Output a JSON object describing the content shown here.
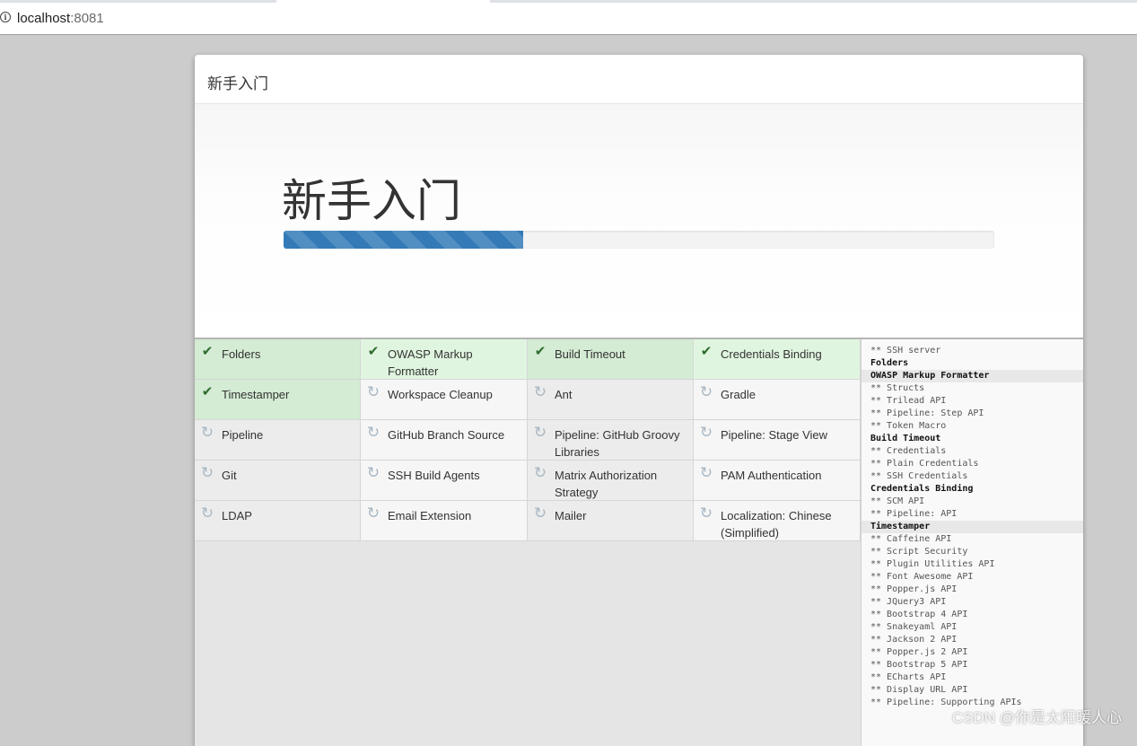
{
  "browser": {
    "host": "localhost",
    "port": ":8081"
  },
  "dialog": {
    "title": "新手入门",
    "hero_title": "新手入门",
    "progress": 0.337
  },
  "plugins": [
    {
      "name": "Folders",
      "status": "done"
    },
    {
      "name": "OWASP Markup Formatter",
      "status": "done"
    },
    {
      "name": "Build Timeout",
      "status": "done"
    },
    {
      "name": "Credentials Binding",
      "status": "done"
    },
    {
      "name": "Timestamper",
      "status": "done"
    },
    {
      "name": "Workspace Cleanup",
      "status": "pending"
    },
    {
      "name": "Ant",
      "status": "pending"
    },
    {
      "name": "Gradle",
      "status": "pending"
    },
    {
      "name": "Pipeline",
      "status": "pending"
    },
    {
      "name": "GitHub Branch Source",
      "status": "pending"
    },
    {
      "name": "Pipeline: GitHub Groovy Libraries",
      "status": "pending"
    },
    {
      "name": "Pipeline: Stage View",
      "status": "pending"
    },
    {
      "name": "Git",
      "status": "pending"
    },
    {
      "name": "SSH Build Agents",
      "status": "pending"
    },
    {
      "name": "Matrix Authorization Strategy",
      "status": "pending"
    },
    {
      "name": "PAM Authentication",
      "status": "pending"
    },
    {
      "name": "LDAP",
      "status": "pending"
    },
    {
      "name": "Email Extension",
      "status": "pending"
    },
    {
      "name": "Mailer",
      "status": "pending"
    },
    {
      "name": "Localization: Chinese (Simplified)",
      "status": "pending"
    }
  ],
  "log": [
    {
      "text": "** SSH server",
      "kind": "dep"
    },
    {
      "text": "Folders",
      "kind": "head"
    },
    {
      "text": "OWASP Markup Formatter",
      "kind": "head",
      "highlight": true
    },
    {
      "text": "** Structs",
      "kind": "dep"
    },
    {
      "text": "** Trilead API",
      "kind": "dep"
    },
    {
      "text": "** Pipeline: Step API",
      "kind": "dep"
    },
    {
      "text": "** Token Macro",
      "kind": "dep"
    },
    {
      "text": "Build Timeout",
      "kind": "head"
    },
    {
      "text": "** Credentials",
      "kind": "dep"
    },
    {
      "text": "** Plain Credentials",
      "kind": "dep"
    },
    {
      "text": "** SSH Credentials",
      "kind": "dep"
    },
    {
      "text": "Credentials Binding",
      "kind": "head"
    },
    {
      "text": "** SCM API",
      "kind": "dep"
    },
    {
      "text": "** Pipeline: API",
      "kind": "dep"
    },
    {
      "text": "Timestamper",
      "kind": "head",
      "highlight": true
    },
    {
      "text": "** Caffeine API",
      "kind": "dep"
    },
    {
      "text": "** Script Security",
      "kind": "dep"
    },
    {
      "text": "** Plugin Utilities API",
      "kind": "dep"
    },
    {
      "text": "** Font Awesome API",
      "kind": "dep"
    },
    {
      "text": "** Popper.js API",
      "kind": "dep"
    },
    {
      "text": "** JQuery3 API",
      "kind": "dep"
    },
    {
      "text": "** Bootstrap 4 API",
      "kind": "dep"
    },
    {
      "text": "** Snakeyaml API",
      "kind": "dep"
    },
    {
      "text": "** Jackson 2 API",
      "kind": "dep"
    },
    {
      "text": "** Popper.js 2 API",
      "kind": "dep"
    },
    {
      "text": "** Bootstrap 5 API",
      "kind": "dep"
    },
    {
      "text": "** ECharts API",
      "kind": "dep"
    },
    {
      "text": "** Display URL API",
      "kind": "dep"
    },
    {
      "text": "** Pipeline: Supporting APIs",
      "kind": "dep"
    }
  ],
  "watermark": "CSDN @你是太阳暖人心",
  "icons": {
    "done": "check-icon",
    "pending": "sync-icon"
  },
  "colors": {
    "progress": "#337ab7",
    "done_bg": "#d4ebd4",
    "check": "#2e6b2e"
  }
}
